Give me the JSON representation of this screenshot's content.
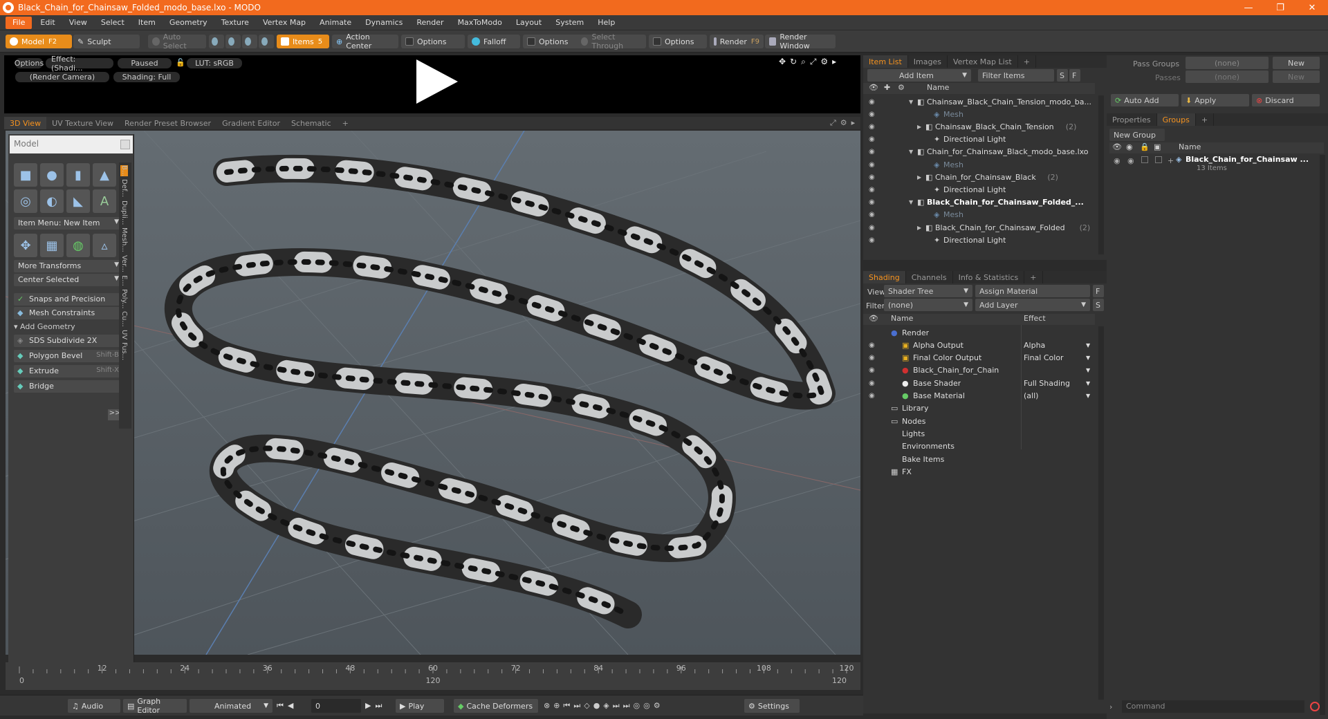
{
  "window": {
    "title": "Black_Chain_for_Chainsaw_Folded_modo_base.lxo - MODO",
    "minimize": "—",
    "restore": "❐",
    "close": "✕"
  },
  "menu": [
    "File",
    "Edit",
    "View",
    "Select",
    "Item",
    "Geometry",
    "Texture",
    "Vertex Map",
    "Animate",
    "Dynamics",
    "Render",
    "MaxToModo",
    "Layout",
    "System",
    "Help"
  ],
  "toolbar": {
    "model": "Model",
    "model_key": "F2",
    "sculpt": "Sculpt",
    "auto_select": "Auto Select",
    "items": "Items",
    "items_key": "5",
    "action_center": "Action Center",
    "options1": "Options",
    "falloff": "Falloff",
    "options2": "Options",
    "select_through": "Select Through",
    "options3": "Options",
    "render": "Render",
    "render_key": "F9",
    "render_window": "Render Window"
  },
  "preview": {
    "options": "Options",
    "effect": "Effect: (Shadi...",
    "paused": "Paused",
    "lut": "LUT: sRGB",
    "camera": "(Render Camera)",
    "shading": "Shading: Full"
  },
  "viewport_tabs": [
    "3D View",
    "UV Texture View",
    "Render Preset Browser",
    "Gradient Editor",
    "Schematic",
    "+"
  ],
  "tool_panel": {
    "title": "Model",
    "item_menu": "Item Menu: New Item",
    "more_transforms": "More Transforms",
    "center_selected": "Center Selected",
    "snaps": "Snaps and Precision",
    "mesh_constraints": "Mesh Constraints",
    "add_geometry": "Add Geometry",
    "sds": "SDS Subdivide 2X",
    "poly_bevel": "Polygon Bevel",
    "poly_bevel_key": "Shift-B",
    "extrude": "Extrude",
    "extrude_key": "Shift-X",
    "bridge": "Bridge",
    "more": ">>",
    "side_tabs": [
      "B...",
      "Def...",
      "Dupli...",
      "Mesh...",
      "Ver...",
      "E...",
      "Poly...",
      "Cu...",
      "UV",
      "Fus..."
    ]
  },
  "timeline": {
    "ticks": [
      "0",
      "12",
      "24",
      "36",
      "48",
      "60",
      "72",
      "84",
      "96",
      "108",
      "120"
    ],
    "start": "0",
    "mid": "120",
    "end": "120"
  },
  "bottombar": {
    "audio": "Audio",
    "graph": "Graph Editor",
    "animated": "Animated",
    "frame": "0",
    "play": "Play",
    "cache": "Cache Deformers",
    "settings": "Settings"
  },
  "item_panel": {
    "tabs": [
      "Item List",
      "Images",
      "Vertex Map List",
      "+"
    ],
    "add_item": "Add Item",
    "filter": "Filter Items",
    "s": "S",
    "f": "F",
    "col_name": "Name",
    "rows": [
      {
        "text": "Chainsaw_Black_Chain_Tension_modo_ba...",
        "indent": 0,
        "bold": false,
        "dim": false,
        "expander": "▼"
      },
      {
        "text": "Mesh",
        "indent": 2,
        "bold": false,
        "dim": true,
        "expander": ""
      },
      {
        "text": "Chainsaw_Black_Chain_Tension",
        "count": "(2)",
        "indent": 1,
        "bold": false,
        "dim": false,
        "expander": "▶"
      },
      {
        "text": "Directional Light",
        "indent": 2,
        "bold": false,
        "dim": false,
        "expander": ""
      },
      {
        "text": "Chain_for_Chainsaw_Black_modo_base.lxo",
        "indent": 0,
        "bold": false,
        "dim": false,
        "expander": "▼"
      },
      {
        "text": "Mesh",
        "indent": 2,
        "bold": false,
        "dim": true,
        "expander": ""
      },
      {
        "text": "Chain_for_Chainsaw_Black",
        "count": "(2)",
        "indent": 1,
        "bold": false,
        "dim": false,
        "expander": "▶"
      },
      {
        "text": "Directional Light",
        "indent": 2,
        "bold": false,
        "dim": false,
        "expander": ""
      },
      {
        "text": "Black_Chain_for_Chainsaw_Folded_...",
        "indent": 0,
        "bold": true,
        "dim": false,
        "expander": "▼"
      },
      {
        "text": "Mesh",
        "indent": 2,
        "bold": false,
        "dim": true,
        "expander": ""
      },
      {
        "text": "Black_Chain_for_Chainsaw_Folded",
        "count": "(2)",
        "indent": 1,
        "bold": false,
        "dim": false,
        "expander": "▶"
      },
      {
        "text": "Directional Light",
        "indent": 2,
        "bold": false,
        "dim": false,
        "expander": ""
      }
    ]
  },
  "shading_panel": {
    "tabs": [
      "Shading",
      "Channels",
      "Info & Statistics",
      "+"
    ],
    "view_label": "View",
    "view_value": "Shader Tree",
    "assign": "Assign Material",
    "f": "F",
    "filter_label": "Filter",
    "filter_value": "(none)",
    "add_layer": "Add Layer",
    "s": "S",
    "col_name": "Name",
    "col_effect": "Effect",
    "rows": [
      {
        "name": "Render",
        "effect": "",
        "indent": 0,
        "eye": false,
        "icon": "render"
      },
      {
        "name": "Alpha Output",
        "effect": "Alpha",
        "indent": 1,
        "eye": true,
        "icon": "output"
      },
      {
        "name": "Final Color Output",
        "effect": "Final Color",
        "indent": 1,
        "eye": true,
        "icon": "output"
      },
      {
        "name": "Black_Chain_for_Chainsaw_...",
        "effect": "",
        "indent": 1,
        "eye": true,
        "icon": "material"
      },
      {
        "name": "Base Shader",
        "effect": "Full Shading",
        "indent": 1,
        "eye": true,
        "icon": "shader"
      },
      {
        "name": "Base Material",
        "effect": "(all)",
        "indent": 1,
        "eye": true,
        "icon": "basemat"
      },
      {
        "name": "Library",
        "effect": "",
        "indent": 0,
        "eye": false,
        "icon": "folder"
      },
      {
        "name": "Nodes",
        "effect": "",
        "indent": 0,
        "eye": false,
        "icon": "folder"
      },
      {
        "name": "Lights",
        "effect": "",
        "indent": 0,
        "eye": false,
        "icon": "none"
      },
      {
        "name": "Environments",
        "effect": "",
        "indent": 0,
        "eye": false,
        "icon": "none"
      },
      {
        "name": "Bake Items",
        "effect": "",
        "indent": 0,
        "eye": false,
        "icon": "none"
      },
      {
        "name": "FX",
        "effect": "",
        "indent": 0,
        "eye": false,
        "icon": "fx"
      }
    ]
  },
  "right_panel": {
    "pass_groups": "Pass Groups",
    "pass_groups_value": "(none)",
    "new": "New",
    "passes": "Passes",
    "passes_value": "(none)",
    "new2": "New",
    "auto_add": "Auto Add",
    "apply": "Apply",
    "discard": "Discard",
    "tabs": [
      "Properties",
      "Groups",
      "+"
    ],
    "new_group": "New Group",
    "col_name": "Name",
    "group_name": "Black_Chain_for_Chainsaw ...",
    "group_count": "13 Items",
    "command": "Command"
  },
  "colors": {
    "accent": "#f26a1e",
    "tab_active": "#f7931e"
  }
}
